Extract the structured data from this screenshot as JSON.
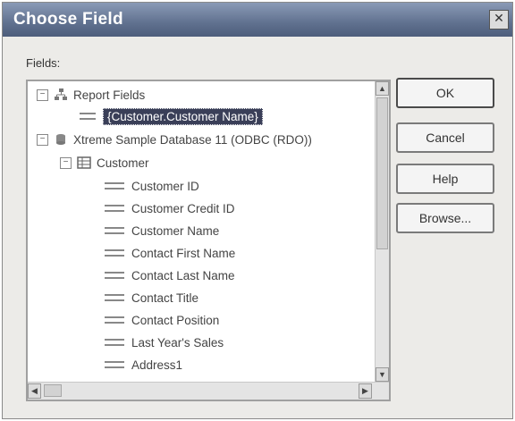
{
  "dialog": {
    "title": "Choose Field",
    "close_glyph": "✕",
    "fields_label": "Fields:"
  },
  "tree": {
    "report_fields": {
      "label": "Report Fields",
      "expander": "−",
      "icon": "report-fields-icon"
    },
    "selected_field": {
      "label": "{Customer.Customer Name}",
      "icon": "field-icon"
    },
    "database": {
      "label": "Xtreme Sample Database 11 (ODBC (RDO))",
      "expander": "−",
      "icon": "database-icon"
    },
    "table": {
      "label": "Customer",
      "expander": "−",
      "icon": "table-icon"
    },
    "fields": [
      "Customer ID",
      "Customer Credit ID",
      "Customer Name",
      "Contact First Name",
      "Contact Last Name",
      "Contact Title",
      "Contact Position",
      "Last Year's Sales",
      "Address1"
    ]
  },
  "buttons": {
    "ok": "OK",
    "cancel": "Cancel",
    "help": "Help",
    "browse": "Browse..."
  }
}
